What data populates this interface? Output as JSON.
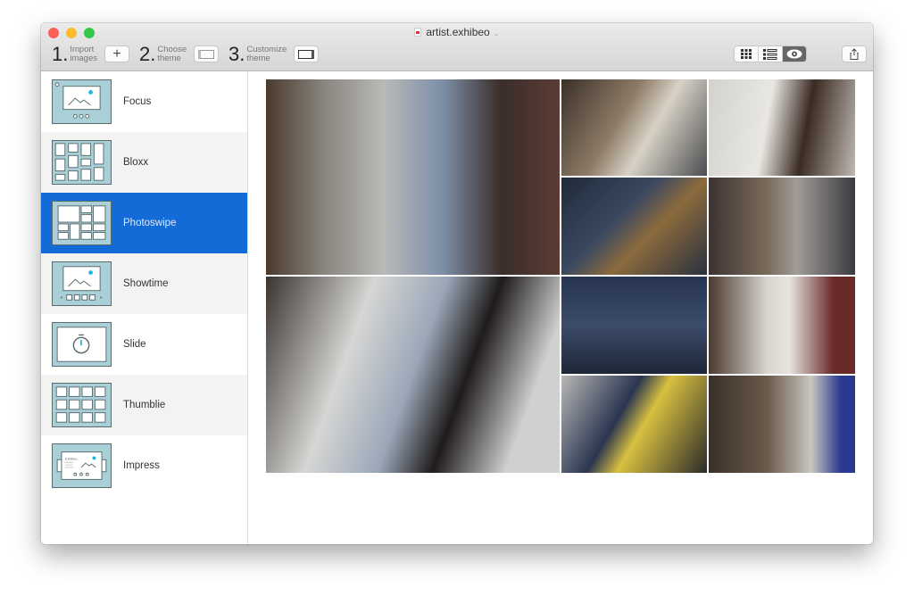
{
  "window": {
    "title": "artist.exhibeo",
    "traffic_lights": [
      "#fc5f57",
      "#fdbc2e",
      "#34c84a"
    ]
  },
  "toolbar": {
    "steps": [
      {
        "num": "1.",
        "label1": "Import",
        "label2": "images",
        "button_icon": "plus-icon"
      },
      {
        "num": "2.",
        "label1": "Choose",
        "label2": "theme",
        "button_icon": "theme-sidebar-icon"
      },
      {
        "num": "3.",
        "label1": "Customize",
        "label2": "theme",
        "button_icon": "inspector-panel-icon"
      }
    ],
    "view_modes": [
      "grid-icon",
      "list-icon",
      "eye-icon"
    ],
    "active_view": "eye-icon",
    "share_icon": "share-icon"
  },
  "sidebar": {
    "selected": "Photoswipe",
    "accent": "#136bd8",
    "items": [
      {
        "label": "Focus"
      },
      {
        "label": "Bloxx"
      },
      {
        "label": "Photoswipe"
      },
      {
        "label": "Showtime"
      },
      {
        "label": "Slide"
      },
      {
        "label": "Thumblie"
      },
      {
        "label": "Impress"
      }
    ]
  },
  "impress_thumb_text": "Exhibeo"
}
